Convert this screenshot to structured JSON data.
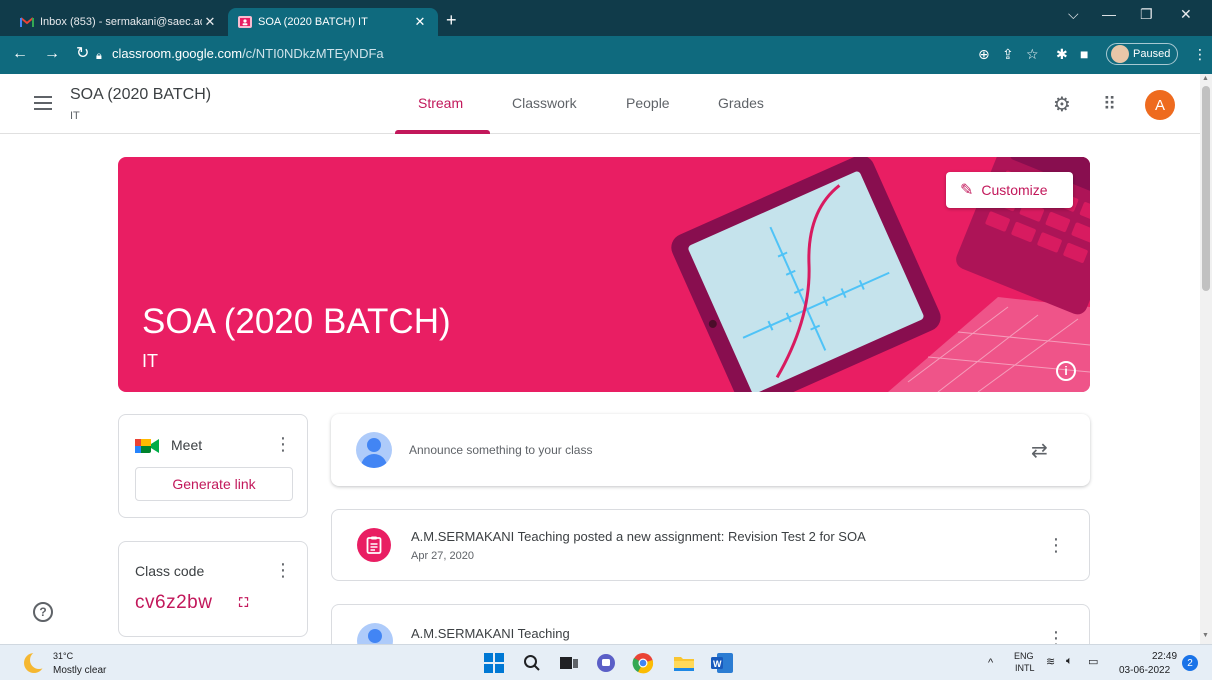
{
  "browser": {
    "tabs": [
      {
        "title": "Inbox (853) - sermakani@saec.ac",
        "active": false,
        "icon": "gmail-icon"
      },
      {
        "title": "SOA (2020 BATCH) IT",
        "active": true,
        "icon": "classroom-icon"
      }
    ],
    "url_domain": "classroom.google.com",
    "url_path": "/c/NTI0NDkzMTEyNDFa",
    "profile_status": "Paused"
  },
  "header": {
    "class_name": "SOA (2020 BATCH)",
    "section": "IT",
    "tabs": [
      {
        "label": "Stream",
        "active": true
      },
      {
        "label": "Classwork",
        "active": false
      },
      {
        "label": "People",
        "active": false
      },
      {
        "label": "Grades",
        "active": false
      }
    ],
    "avatar_letter": "A"
  },
  "banner": {
    "title": "SOA (2020 BATCH)",
    "subtitle": "IT",
    "customize_label": "Customize",
    "color": "#e91e63"
  },
  "meet": {
    "label": "Meet",
    "generate_link_label": "Generate link"
  },
  "class_code": {
    "label": "Class code",
    "code": "cv6z2bw"
  },
  "stream": {
    "announce_placeholder": "Announce something to your class",
    "posts": [
      {
        "title": "A.M.SERMAKANI Teaching posted a new assignment: Revision Test 2 for SOA",
        "date": "Apr 27, 2020",
        "icon": "assignment-icon"
      },
      {
        "title": "A.M.SERMAKANI Teaching",
        "date": "",
        "icon": "user-avatar"
      }
    ]
  },
  "taskbar": {
    "weather_temp": "31°C",
    "weather_desc": "Mostly clear",
    "lang_top": "ENG",
    "lang_bottom": "INTL",
    "time": "22:49",
    "date": "03-06-2022",
    "notifications": "2"
  },
  "colors": {
    "accent": "#c2185b",
    "browser_frame": "#103b4a",
    "address_bar": "#0f6a7e"
  }
}
